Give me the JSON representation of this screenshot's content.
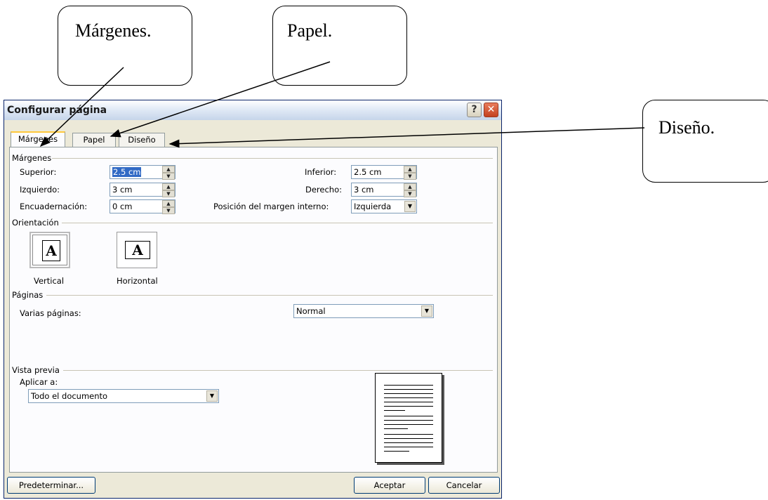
{
  "callouts": {
    "margenes": "Márgenes.",
    "papel": "Papel.",
    "diseno": "Diseño."
  },
  "dialog": {
    "title": "Configurar página",
    "tabs": [
      {
        "label": "Márgenes",
        "active": true
      },
      {
        "label": "Papel",
        "active": false
      },
      {
        "label": "Diseño",
        "active": false
      }
    ],
    "margins_group": {
      "title": "Márgenes",
      "superior": {
        "label": "Superior:",
        "value": "2.5 cm"
      },
      "inferior": {
        "label": "Inferior:",
        "value": "2.5 cm"
      },
      "izquierdo": {
        "label": "Izquierdo:",
        "value": "3 cm"
      },
      "derecho": {
        "label": "Derecho:",
        "value": "3 cm"
      },
      "encuadernacion": {
        "label": "Encuadernación:",
        "value": "0 cm"
      },
      "posicion": {
        "label": "Posición del margen interno:",
        "value": "Izquierda"
      }
    },
    "orientation_group": {
      "title": "Orientación",
      "vertical": "Vertical",
      "horizontal": "Horizontal",
      "glyph": "A",
      "selected": "Vertical"
    },
    "pages_group": {
      "title": "Páginas",
      "varias_label": "Varias páginas:",
      "varias_value": "Normal"
    },
    "preview_group": {
      "title": "Vista previa",
      "aplicar_label": "Aplicar a:",
      "aplicar_value": "Todo el documento"
    },
    "buttons": {
      "default": "Predeterminar...",
      "ok": "Aceptar",
      "cancel": "Cancelar"
    }
  },
  "colors": {
    "dialog_bg": "#ece9d8",
    "panel_bg": "#fcfcfe",
    "selection": "#316ac5",
    "close_button": "#c3411f",
    "active_tab_accent": "#ffc83c"
  },
  "icons": [
    "help-icon",
    "close-icon",
    "spin-up-icon",
    "spin-down-icon",
    "dropdown-arrow-icon",
    "portrait-page-icon",
    "landscape-page-icon"
  ]
}
